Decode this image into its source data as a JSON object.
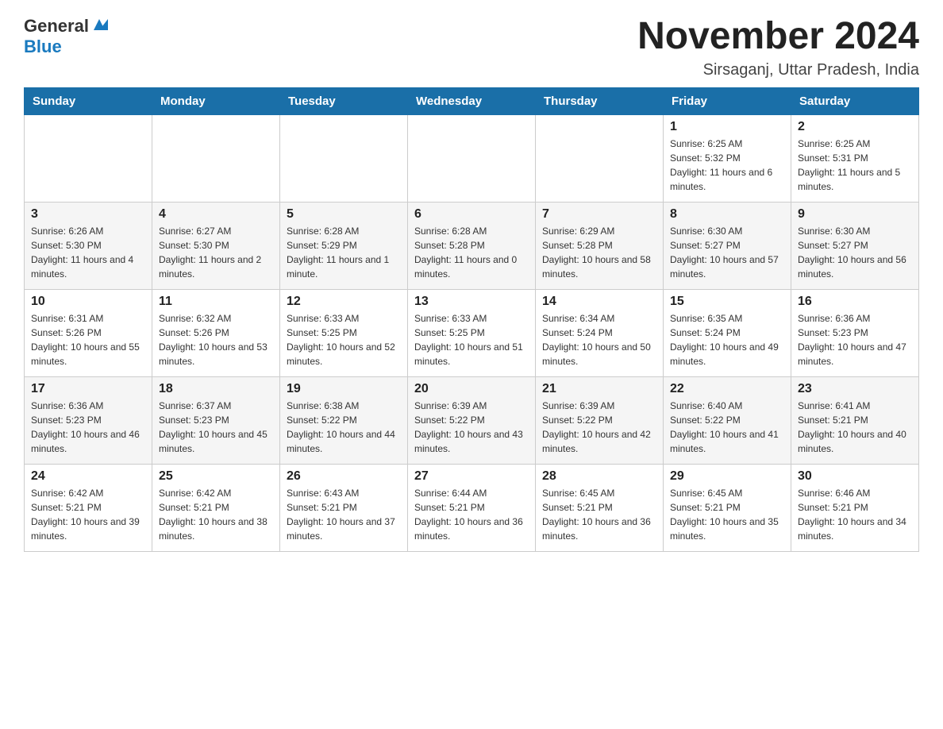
{
  "header": {
    "logo_general": "General",
    "logo_blue": "Blue",
    "month_title": "November 2024",
    "location": "Sirsaganj, Uttar Pradesh, India"
  },
  "days_of_week": [
    "Sunday",
    "Monday",
    "Tuesday",
    "Wednesday",
    "Thursday",
    "Friday",
    "Saturday"
  ],
  "weeks": [
    [
      {
        "day": "",
        "sunrise": "",
        "sunset": "",
        "daylight": ""
      },
      {
        "day": "",
        "sunrise": "",
        "sunset": "",
        "daylight": ""
      },
      {
        "day": "",
        "sunrise": "",
        "sunset": "",
        "daylight": ""
      },
      {
        "day": "",
        "sunrise": "",
        "sunset": "",
        "daylight": ""
      },
      {
        "day": "",
        "sunrise": "",
        "sunset": "",
        "daylight": ""
      },
      {
        "day": "1",
        "sunrise": "Sunrise: 6:25 AM",
        "sunset": "Sunset: 5:32 PM",
        "daylight": "Daylight: 11 hours and 6 minutes."
      },
      {
        "day": "2",
        "sunrise": "Sunrise: 6:25 AM",
        "sunset": "Sunset: 5:31 PM",
        "daylight": "Daylight: 11 hours and 5 minutes."
      }
    ],
    [
      {
        "day": "3",
        "sunrise": "Sunrise: 6:26 AM",
        "sunset": "Sunset: 5:30 PM",
        "daylight": "Daylight: 11 hours and 4 minutes."
      },
      {
        "day": "4",
        "sunrise": "Sunrise: 6:27 AM",
        "sunset": "Sunset: 5:30 PM",
        "daylight": "Daylight: 11 hours and 2 minutes."
      },
      {
        "day": "5",
        "sunrise": "Sunrise: 6:28 AM",
        "sunset": "Sunset: 5:29 PM",
        "daylight": "Daylight: 11 hours and 1 minute."
      },
      {
        "day": "6",
        "sunrise": "Sunrise: 6:28 AM",
        "sunset": "Sunset: 5:28 PM",
        "daylight": "Daylight: 11 hours and 0 minutes."
      },
      {
        "day": "7",
        "sunrise": "Sunrise: 6:29 AM",
        "sunset": "Sunset: 5:28 PM",
        "daylight": "Daylight: 10 hours and 58 minutes."
      },
      {
        "day": "8",
        "sunrise": "Sunrise: 6:30 AM",
        "sunset": "Sunset: 5:27 PM",
        "daylight": "Daylight: 10 hours and 57 minutes."
      },
      {
        "day": "9",
        "sunrise": "Sunrise: 6:30 AM",
        "sunset": "Sunset: 5:27 PM",
        "daylight": "Daylight: 10 hours and 56 minutes."
      }
    ],
    [
      {
        "day": "10",
        "sunrise": "Sunrise: 6:31 AM",
        "sunset": "Sunset: 5:26 PM",
        "daylight": "Daylight: 10 hours and 55 minutes."
      },
      {
        "day": "11",
        "sunrise": "Sunrise: 6:32 AM",
        "sunset": "Sunset: 5:26 PM",
        "daylight": "Daylight: 10 hours and 53 minutes."
      },
      {
        "day": "12",
        "sunrise": "Sunrise: 6:33 AM",
        "sunset": "Sunset: 5:25 PM",
        "daylight": "Daylight: 10 hours and 52 minutes."
      },
      {
        "day": "13",
        "sunrise": "Sunrise: 6:33 AM",
        "sunset": "Sunset: 5:25 PM",
        "daylight": "Daylight: 10 hours and 51 minutes."
      },
      {
        "day": "14",
        "sunrise": "Sunrise: 6:34 AM",
        "sunset": "Sunset: 5:24 PM",
        "daylight": "Daylight: 10 hours and 50 minutes."
      },
      {
        "day": "15",
        "sunrise": "Sunrise: 6:35 AM",
        "sunset": "Sunset: 5:24 PM",
        "daylight": "Daylight: 10 hours and 49 minutes."
      },
      {
        "day": "16",
        "sunrise": "Sunrise: 6:36 AM",
        "sunset": "Sunset: 5:23 PM",
        "daylight": "Daylight: 10 hours and 47 minutes."
      }
    ],
    [
      {
        "day": "17",
        "sunrise": "Sunrise: 6:36 AM",
        "sunset": "Sunset: 5:23 PM",
        "daylight": "Daylight: 10 hours and 46 minutes."
      },
      {
        "day": "18",
        "sunrise": "Sunrise: 6:37 AM",
        "sunset": "Sunset: 5:23 PM",
        "daylight": "Daylight: 10 hours and 45 minutes."
      },
      {
        "day": "19",
        "sunrise": "Sunrise: 6:38 AM",
        "sunset": "Sunset: 5:22 PM",
        "daylight": "Daylight: 10 hours and 44 minutes."
      },
      {
        "day": "20",
        "sunrise": "Sunrise: 6:39 AM",
        "sunset": "Sunset: 5:22 PM",
        "daylight": "Daylight: 10 hours and 43 minutes."
      },
      {
        "day": "21",
        "sunrise": "Sunrise: 6:39 AM",
        "sunset": "Sunset: 5:22 PM",
        "daylight": "Daylight: 10 hours and 42 minutes."
      },
      {
        "day": "22",
        "sunrise": "Sunrise: 6:40 AM",
        "sunset": "Sunset: 5:22 PM",
        "daylight": "Daylight: 10 hours and 41 minutes."
      },
      {
        "day": "23",
        "sunrise": "Sunrise: 6:41 AM",
        "sunset": "Sunset: 5:21 PM",
        "daylight": "Daylight: 10 hours and 40 minutes."
      }
    ],
    [
      {
        "day": "24",
        "sunrise": "Sunrise: 6:42 AM",
        "sunset": "Sunset: 5:21 PM",
        "daylight": "Daylight: 10 hours and 39 minutes."
      },
      {
        "day": "25",
        "sunrise": "Sunrise: 6:42 AM",
        "sunset": "Sunset: 5:21 PM",
        "daylight": "Daylight: 10 hours and 38 minutes."
      },
      {
        "day": "26",
        "sunrise": "Sunrise: 6:43 AM",
        "sunset": "Sunset: 5:21 PM",
        "daylight": "Daylight: 10 hours and 37 minutes."
      },
      {
        "day": "27",
        "sunrise": "Sunrise: 6:44 AM",
        "sunset": "Sunset: 5:21 PM",
        "daylight": "Daylight: 10 hours and 36 minutes."
      },
      {
        "day": "28",
        "sunrise": "Sunrise: 6:45 AM",
        "sunset": "Sunset: 5:21 PM",
        "daylight": "Daylight: 10 hours and 36 minutes."
      },
      {
        "day": "29",
        "sunrise": "Sunrise: 6:45 AM",
        "sunset": "Sunset: 5:21 PM",
        "daylight": "Daylight: 10 hours and 35 minutes."
      },
      {
        "day": "30",
        "sunrise": "Sunrise: 6:46 AM",
        "sunset": "Sunset: 5:21 PM",
        "daylight": "Daylight: 10 hours and 34 minutes."
      }
    ]
  ]
}
